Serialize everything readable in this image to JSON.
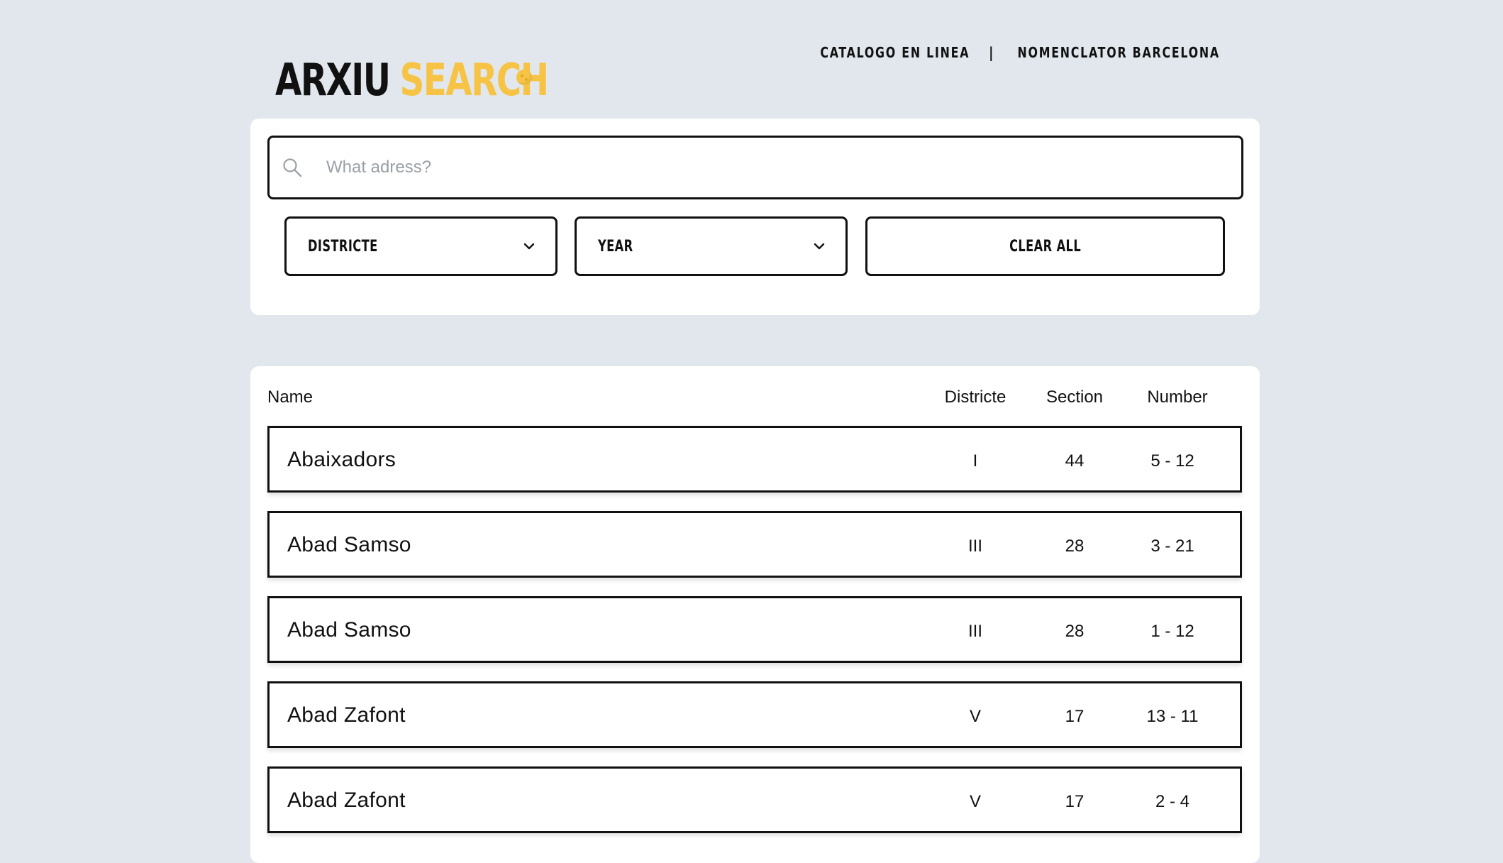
{
  "brand": {
    "word_1": "ARXIU",
    "word_2": "SEARCH",
    "accent_color": "#f6c344",
    "logo_icon": "ball-icon"
  },
  "top_nav": {
    "links": [
      "CATALOGO EN LINEA",
      "NOMENCLATOR BARCELONA"
    ],
    "separator": "|"
  },
  "search": {
    "placeholder": "What adress?",
    "value": "",
    "icon": "search-icon"
  },
  "filters": {
    "districte_label": "DISTRICTE",
    "year_label": "YEAR",
    "clear_label": "CLEAR ALL",
    "dropdown_icon": "chevron-down-icon"
  },
  "table": {
    "headers": {
      "name": "Name",
      "districte": "Districte",
      "section": "Section",
      "number": "Number"
    },
    "rows": [
      {
        "name": "Abaixadors",
        "districte": "I",
        "section": "44",
        "number": "5 - 12"
      },
      {
        "name": "Abad Samso",
        "districte": "III",
        "section": "28",
        "number": "3 - 21"
      },
      {
        "name": "Abad Samso",
        "districte": "III",
        "section": "28",
        "number": "1 - 12"
      },
      {
        "name": "Abad Zafont",
        "districte": "V",
        "section": "17",
        "number": "13 - 11"
      },
      {
        "name": "Abad Zafont",
        "districte": "V",
        "section": "17",
        "number": "2 - 4"
      }
    ]
  },
  "colors": {
    "background": "#e1e7ed",
    "panel": "#ffffff",
    "border": "#111111",
    "accent": "#f6c344"
  }
}
